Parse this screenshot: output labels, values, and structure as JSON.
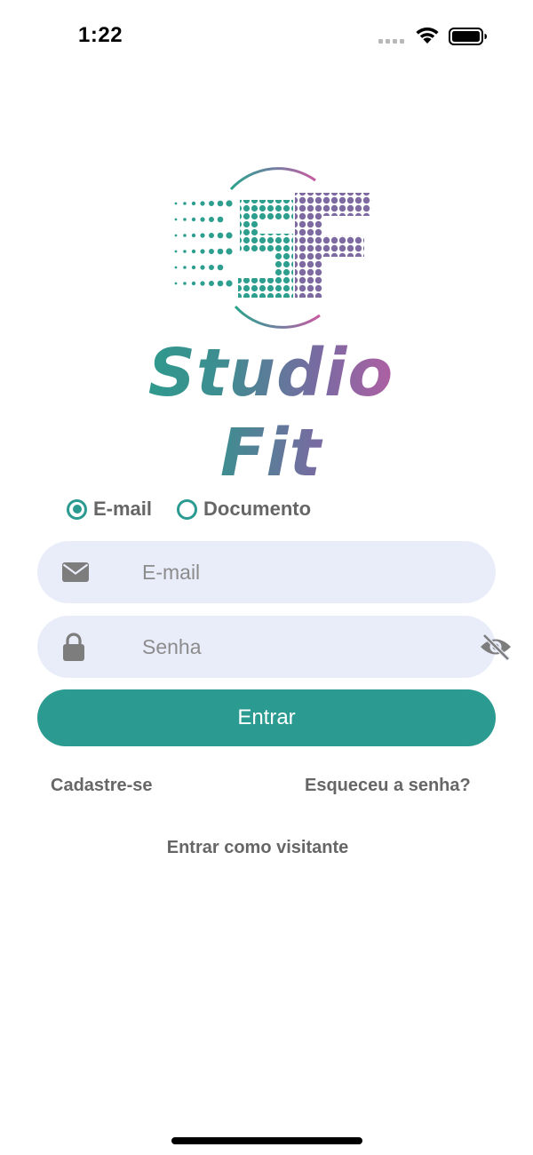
{
  "status_bar": {
    "time": "1:22",
    "icons": [
      "signal-icon",
      "wifi-icon",
      "battery-icon"
    ]
  },
  "brand": {
    "name": "Studio Fit",
    "monogram": "SF",
    "colors": {
      "teal": "#27a08b",
      "purple": "#7a6aa2",
      "pink": "#cc5aa2"
    }
  },
  "login_type": {
    "options": [
      {
        "label": "E-mail",
        "selected": true
      },
      {
        "label": "Documento",
        "selected": false
      }
    ]
  },
  "email_input": {
    "placeholder": "E-mail",
    "value": "",
    "icon": "envelope-icon"
  },
  "password_input": {
    "placeholder": "Senha",
    "value": "",
    "icon": "lock-icon",
    "toggle_icon": "eye-slash-icon"
  },
  "submit_label": "Entrar",
  "links": {
    "signup": "Cadastre-se",
    "forgot_password": "Esqueceu a senha?",
    "guest": "Entrar como visitante"
  },
  "theme": {
    "primary": "#2b9a91",
    "input_bg": "#e9edf9",
    "text_muted": "#666666"
  }
}
